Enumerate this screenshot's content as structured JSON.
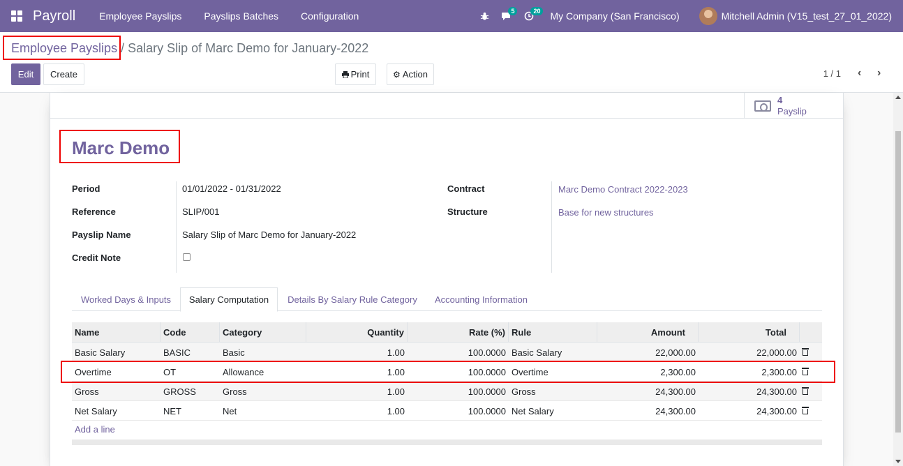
{
  "navbar": {
    "brand": "Payroll",
    "menu": [
      "Employee Payslips",
      "Payslips Batches",
      "Configuration"
    ],
    "chat_count": "5",
    "activity_count": "20",
    "company": "My Company (San Francisco)",
    "user": "Mitchell Admin (V15_test_27_01_2022)"
  },
  "breadcrumb": {
    "parent": "Employee Payslips",
    "separator": "/",
    "current": "Salary Slip of Marc Demo for January-2022"
  },
  "toolbar": {
    "edit_label": "Edit",
    "create_label": "Create",
    "print_label": "Print",
    "action_label": "Action",
    "pager": "1 / 1"
  },
  "smart_button": {
    "value": "4",
    "label": "Payslip"
  },
  "form": {
    "employee": "Marc Demo",
    "left_fields": [
      {
        "label": "Period",
        "value": "01/01/2022 - 01/31/2022"
      },
      {
        "label": "Reference",
        "value": "SLIP/001"
      },
      {
        "label": "Payslip Name",
        "value": "Salary Slip of Marc Demo for January-2022"
      },
      {
        "label": "Credit Note",
        "value": ""
      }
    ],
    "right_fields": [
      {
        "label": "Contract",
        "value": "Marc Demo Contract 2022-2023"
      },
      {
        "label": "Structure",
        "value": "Base for new structures"
      }
    ]
  },
  "tabs": [
    "Worked Days & Inputs",
    "Salary Computation",
    "Details By Salary Rule Category",
    "Accounting Information"
  ],
  "table": {
    "headers": [
      "Name",
      "Code",
      "Category",
      "Quantity",
      "Rate (%)",
      "Rule",
      "Amount",
      "Total"
    ],
    "rows": [
      [
        "Basic Salary",
        "BASIC",
        "Basic",
        "1.00",
        "100.0000",
        "Basic Salary",
        "22,000.00",
        "22,000.00"
      ],
      [
        "Overtime",
        "OT",
        "Allowance",
        "1.00",
        "100.0000",
        "Overtime",
        "2,300.00",
        "2,300.00"
      ],
      [
        "Gross",
        "GROSS",
        "Gross",
        "1.00",
        "100.0000",
        "Gross",
        "24,300.00",
        "24,300.00"
      ],
      [
        "Net Salary",
        "NET",
        "Net",
        "1.00",
        "100.0000",
        "Net Salary",
        "24,300.00",
        "24,300.00"
      ]
    ],
    "add_line": "Add a line"
  },
  "colors": {
    "brand": "#71639e",
    "highlight": "#e00000"
  }
}
